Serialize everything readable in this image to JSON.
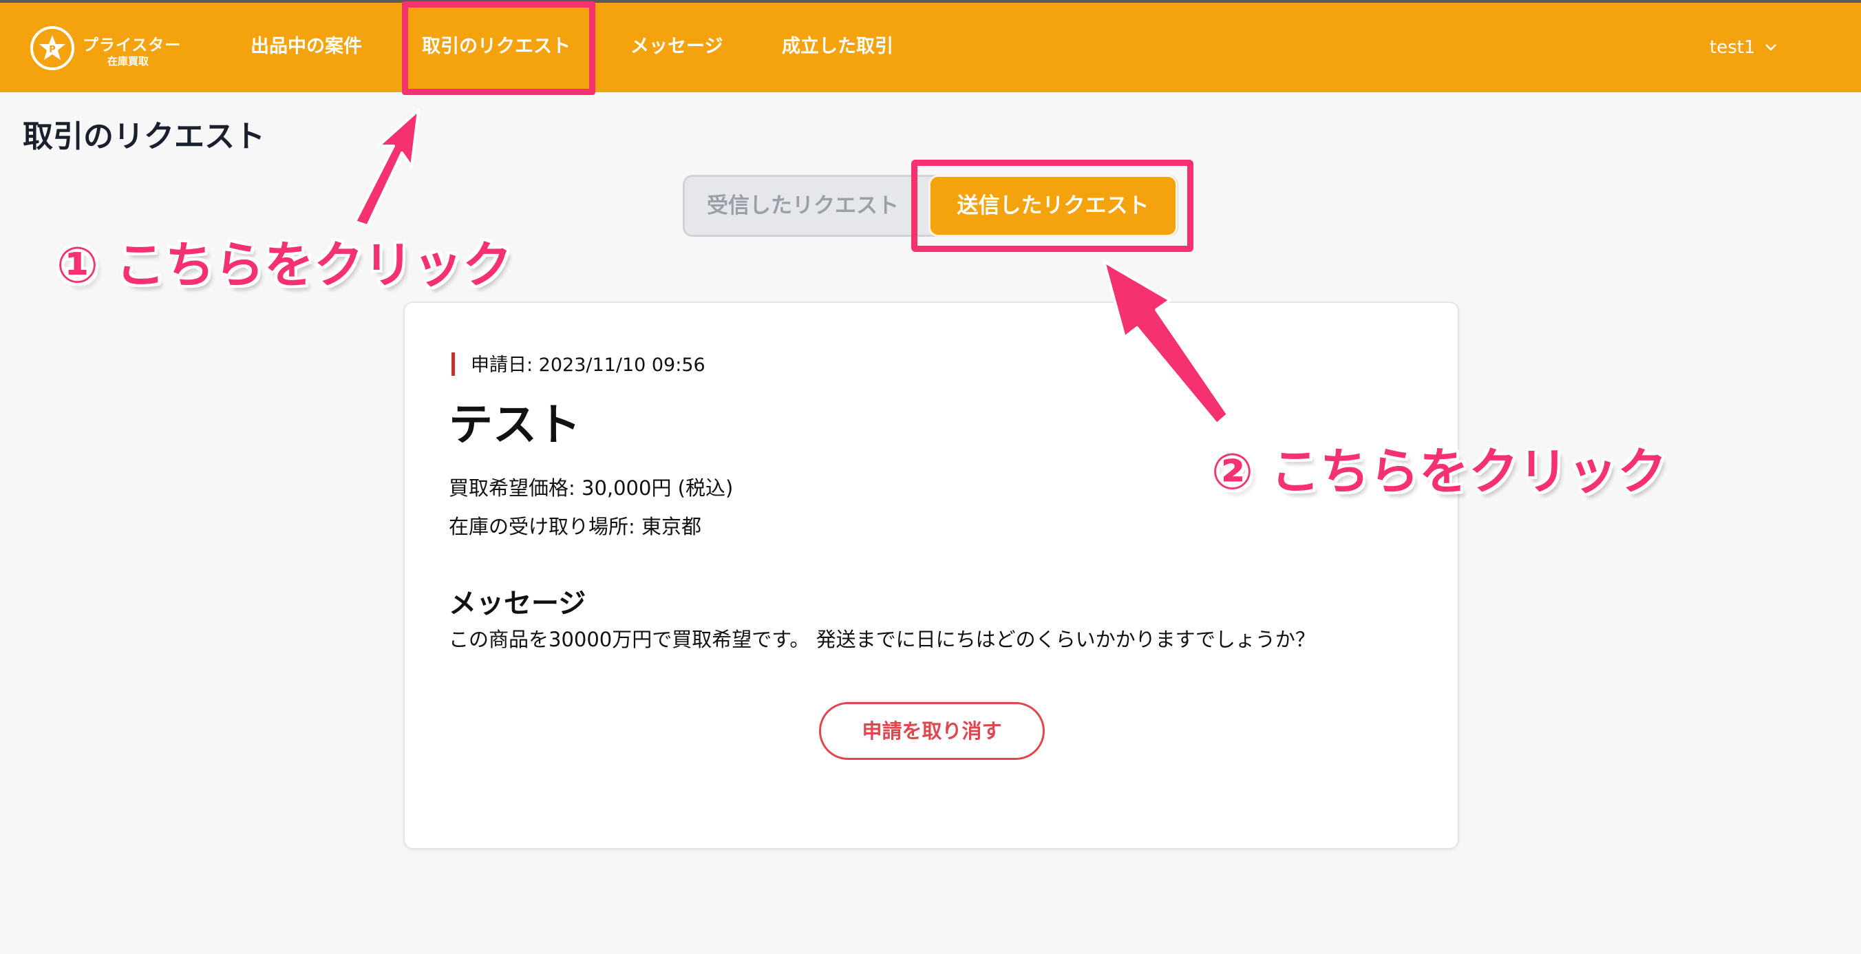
{
  "navbar": {
    "logo_name": "プライスター",
    "logo_sub": "在庫買取",
    "items": [
      {
        "label": "出品中の案件"
      },
      {
        "label": "取引のリクエスト"
      },
      {
        "label": "メッセージ"
      },
      {
        "label": "成立した取引"
      }
    ],
    "user": "test1"
  },
  "page": {
    "title": "取引のリクエスト"
  },
  "tabs": {
    "received": "受信したリクエスト",
    "sent": "送信したリクエスト",
    "active": "sent"
  },
  "request": {
    "date": "申請日: 2023/11/10 09:56",
    "title": "テスト",
    "price": "買取希望価格: 30,000円 (税込)",
    "place": "在庫の受け取り場所: 東京都",
    "message_heading": "メッセージ",
    "message": "この商品を30000万円で買取希望です。 発送までに日にちはどのくらいかかりますでしょうか？",
    "cancel_label": "申請を取り消す"
  },
  "annotations": {
    "callout_1": "① こちらをクリック",
    "callout_2": "② こちらをクリック",
    "accent_color": "#f5326f"
  },
  "colors": {
    "brand": "#f5a20f",
    "danger": "#e0464d"
  }
}
